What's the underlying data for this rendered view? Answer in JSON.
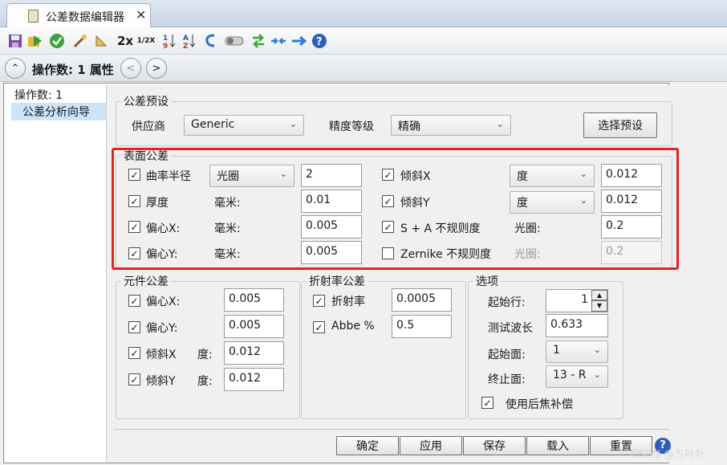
{
  "tab": {
    "title": "公差数据编辑器",
    "close": "✕"
  },
  "toolbar": {
    "zoom2x": "2x",
    "half": "1/2X"
  },
  "opbar": {
    "label": "操作数: 1 属性",
    "collapse": "⌃",
    "prev": "<",
    "next": ">"
  },
  "nav": {
    "items": [
      "操作数: 1",
      "公差分析向导"
    ]
  },
  "preset": {
    "group_title": "公差预设",
    "vendor_label": "供应商",
    "vendor_value": "Generic",
    "grade_label": "精度等级",
    "grade_value": "精确",
    "select_button": "选择预设"
  },
  "surface": {
    "group_title": "表面公差",
    "radius": {
      "label": "曲率半径",
      "mode": "光圈",
      "value": "2"
    },
    "thickness": {
      "label": "厚度",
      "unit": "毫米:",
      "value": "0.01"
    },
    "decx": {
      "label": "偏心X:",
      "unit": "毫米:",
      "value": "0.005"
    },
    "decy": {
      "label": "偏心Y:",
      "unit": "毫米:",
      "value": "0.005"
    },
    "tiltx": {
      "label": "倾斜X",
      "unit": "度",
      "value": "0.012"
    },
    "tilty": {
      "label": "倾斜Y",
      "unit": "度",
      "value": "0.012"
    },
    "sa": {
      "label": "S + A 不规则度",
      "unit": "光圈:",
      "value": "0.2"
    },
    "zernike": {
      "label": "Zernike 不规则度",
      "unit": "光圈:",
      "value": "0.2"
    }
  },
  "element": {
    "group_title": "元件公差",
    "decx": {
      "label": "偏心X:",
      "value": "0.005"
    },
    "decy": {
      "label": "偏心Y:",
      "value": "0.005"
    },
    "tiltx": {
      "label": "倾斜X",
      "unit": "度:",
      "value": "0.012"
    },
    "tilty": {
      "label": "倾斜Y",
      "unit": "度:",
      "value": "0.012"
    }
  },
  "index": {
    "group_title": "折射率公差",
    "index": {
      "label": "折射率",
      "value": "0.0005"
    },
    "abbe": {
      "label": "Abbe %",
      "value": "0.5"
    }
  },
  "options": {
    "group_title": "选项",
    "start_row_label": "起始行:",
    "start_row_value": "1",
    "wavelength_label": "测试波长",
    "wavelength_value": "0.633",
    "start_face_label": "起始面:",
    "start_face_value": "1",
    "end_face_label": "终止面:",
    "end_face_value": "13 - R",
    "backfocus_label": "使用后焦补偿"
  },
  "footer": {
    "ok": "确定",
    "apply": "应用",
    "save": "保存",
    "load": "载入",
    "reset": "重置",
    "help": "?"
  },
  "watermark": "CSDN @万叶叶",
  "colors": {
    "highlight_border": "#e62121",
    "nav_selected": "#cce4f7"
  }
}
